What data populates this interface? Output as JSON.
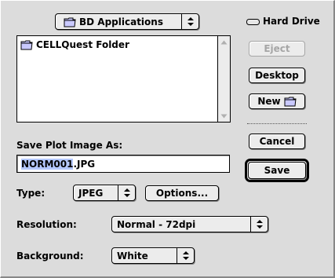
{
  "location_popup": {
    "label": "BD Applications",
    "icon": "folder-icon"
  },
  "drive": {
    "label": "Hard Drive",
    "icon": "hard-drive-icon"
  },
  "file_list": {
    "items": [
      {
        "name": "CELLQuest Folder",
        "icon": "folder-icon"
      }
    ]
  },
  "buttons": {
    "eject": "Eject",
    "desktop": "Desktop",
    "new": "New",
    "cancel": "Cancel",
    "save": "Save",
    "options": "Options..."
  },
  "save_as": {
    "label": "Save Plot Image As:",
    "filename_selected": "NORM001",
    "filename_rest": ".JPG"
  },
  "type": {
    "label": "Type:",
    "value": "JPEG"
  },
  "resolution": {
    "label": "Resolution:",
    "value": "Normal - 72dpi"
  },
  "background": {
    "label": "Background:",
    "value": "White"
  },
  "colors": {
    "selection": "#b4c8ff",
    "dialog_bg": "#dcdcdc",
    "disabled_text": "#a6a6a6"
  }
}
